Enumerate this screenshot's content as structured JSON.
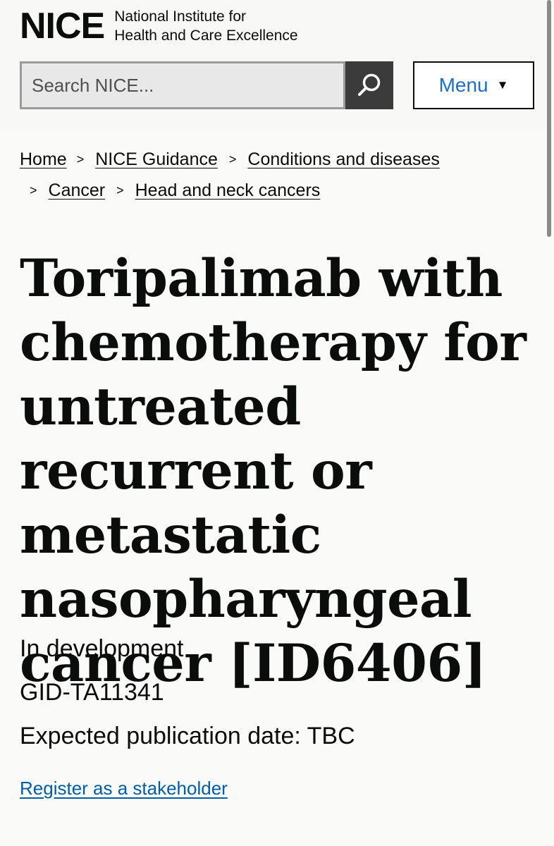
{
  "header": {
    "logo_mark": "NICE",
    "logo_line1": "National Institute for",
    "logo_line2": "Health and Care Excellence",
    "search": {
      "placeholder": "Search NICE..."
    },
    "menu_label": "Menu",
    "menu_caret": "▼"
  },
  "breadcrumb": {
    "separator": ">",
    "items": [
      {
        "label": "Home"
      },
      {
        "label": "NICE Guidance"
      },
      {
        "label": "Conditions and diseases"
      },
      {
        "label": "Cancer"
      },
      {
        "label": "Head and neck cancers"
      }
    ]
  },
  "main": {
    "title": "Toripalimab with chemotherapy for untreated recurrent or metastatic nasopharyngeal cancer [ID6406]",
    "status": "In development",
    "reference": "GID-TA11341",
    "publication_date": "Expected publication date: TBC",
    "stakeholder_link": "Register as a stakeholder"
  }
}
